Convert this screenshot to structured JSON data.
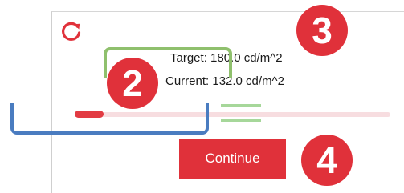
{
  "panel": {
    "refresh_icon": "refresh-icon",
    "target_text": "Target: 180.0 cd/m^2",
    "current_text": "Current: 132.0 cd/m^2",
    "continue_label": "Continue"
  },
  "annotations": {
    "badge_2": "2",
    "badge_3": "3",
    "badge_4": "4"
  },
  "colors": {
    "accent": "#e0313a",
    "track": "#f7dde0",
    "target_zone": "#a6d79a",
    "bracket_green": "#8fc06d",
    "bracket_blue": "#4a7cc0"
  }
}
